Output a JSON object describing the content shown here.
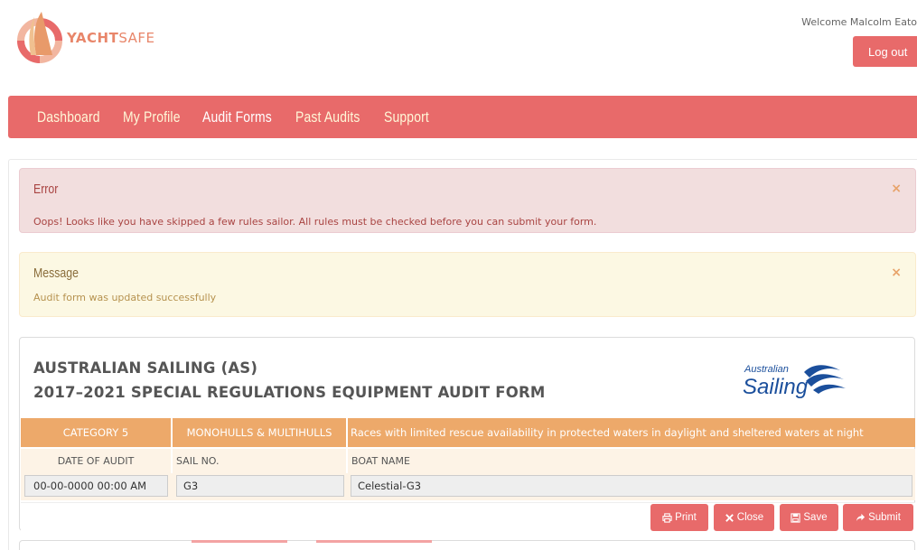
{
  "header": {
    "brand": {
      "bold": "YACHT",
      "light": "SAFE"
    },
    "welcome_text": "Welcome Malcolm Eato",
    "logout_label": "Log out"
  },
  "nav": {
    "items": [
      {
        "label": "Dashboard"
      },
      {
        "label": "My Profile"
      },
      {
        "label": "Audit Forms"
      },
      {
        "label": "Past Audits"
      },
      {
        "label": "Support"
      }
    ]
  },
  "alerts": {
    "error": {
      "title": "Error",
      "text": "Oops! Looks like you have skipped a few rules sailor. All rules must be checked before you can submit your form.",
      "close": "×"
    },
    "message": {
      "title": "Message",
      "text": "Audit form was updated successfully",
      "close": "×"
    }
  },
  "form": {
    "title_line1": "AUSTRALIAN SAILING (AS)",
    "title_line2": "2017–2021 SPECIAL REGULATIONS EQUIPMENT AUDIT FORM",
    "logo": {
      "line1": "Australian",
      "line2": "Sailing"
    },
    "category": {
      "label": "CATEGORY 5",
      "hull_type": "MONOHULLS & MULTIHULLS",
      "description": "Races with limited rescue availability in protected waters in daylight and sheltered waters at night"
    },
    "fields": {
      "date_label": "DATE OF AUDIT",
      "date_value": "00-00-0000 00:00 AM",
      "sail_label": "SAIL NO.",
      "sail_value": "G3",
      "boat_label": "BOAT NAME",
      "boat_value": "Celestial-G3"
    },
    "actions": {
      "print": "Print",
      "close": "Close",
      "save": "Save",
      "submit": "Submit"
    }
  },
  "colors": {
    "accent": "#e86a6a",
    "category_bar": "#eda96a",
    "error_bg": "#f2dede",
    "message_bg": "#fcf8e3"
  }
}
